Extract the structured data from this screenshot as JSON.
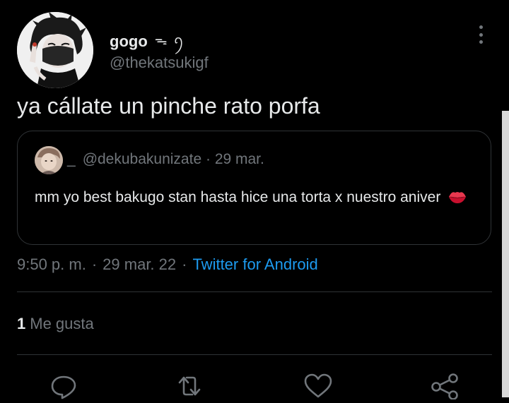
{
  "tweet": {
    "author": {
      "display_name": "gogo",
      "name_decoration": "ᯓ ꪆ",
      "handle": "@thekatsukigf"
    },
    "text": "ya cállate un pinche rato porfa",
    "quoted": {
      "name_placeholder": "_",
      "handle": "@dekubakunizate",
      "separator": "·",
      "date": "29 mar.",
      "text": "mm yo best bakugo stan hasta hice una torta x nuestro aniver"
    },
    "time": "9:50 p. m.",
    "date": "29 mar. 22",
    "separator": "·",
    "source": "Twitter for Android",
    "likes": {
      "count": "1",
      "label": "Me gusta"
    }
  },
  "actions": {
    "icons": [
      "reply-icon",
      "retweet-icon",
      "like-icon",
      "share-icon"
    ]
  },
  "colors": {
    "background": "#000000",
    "text_primary": "#e7e9ea",
    "text_secondary": "#71767b",
    "link": "#1d9bf0",
    "border": "#2f3336"
  }
}
